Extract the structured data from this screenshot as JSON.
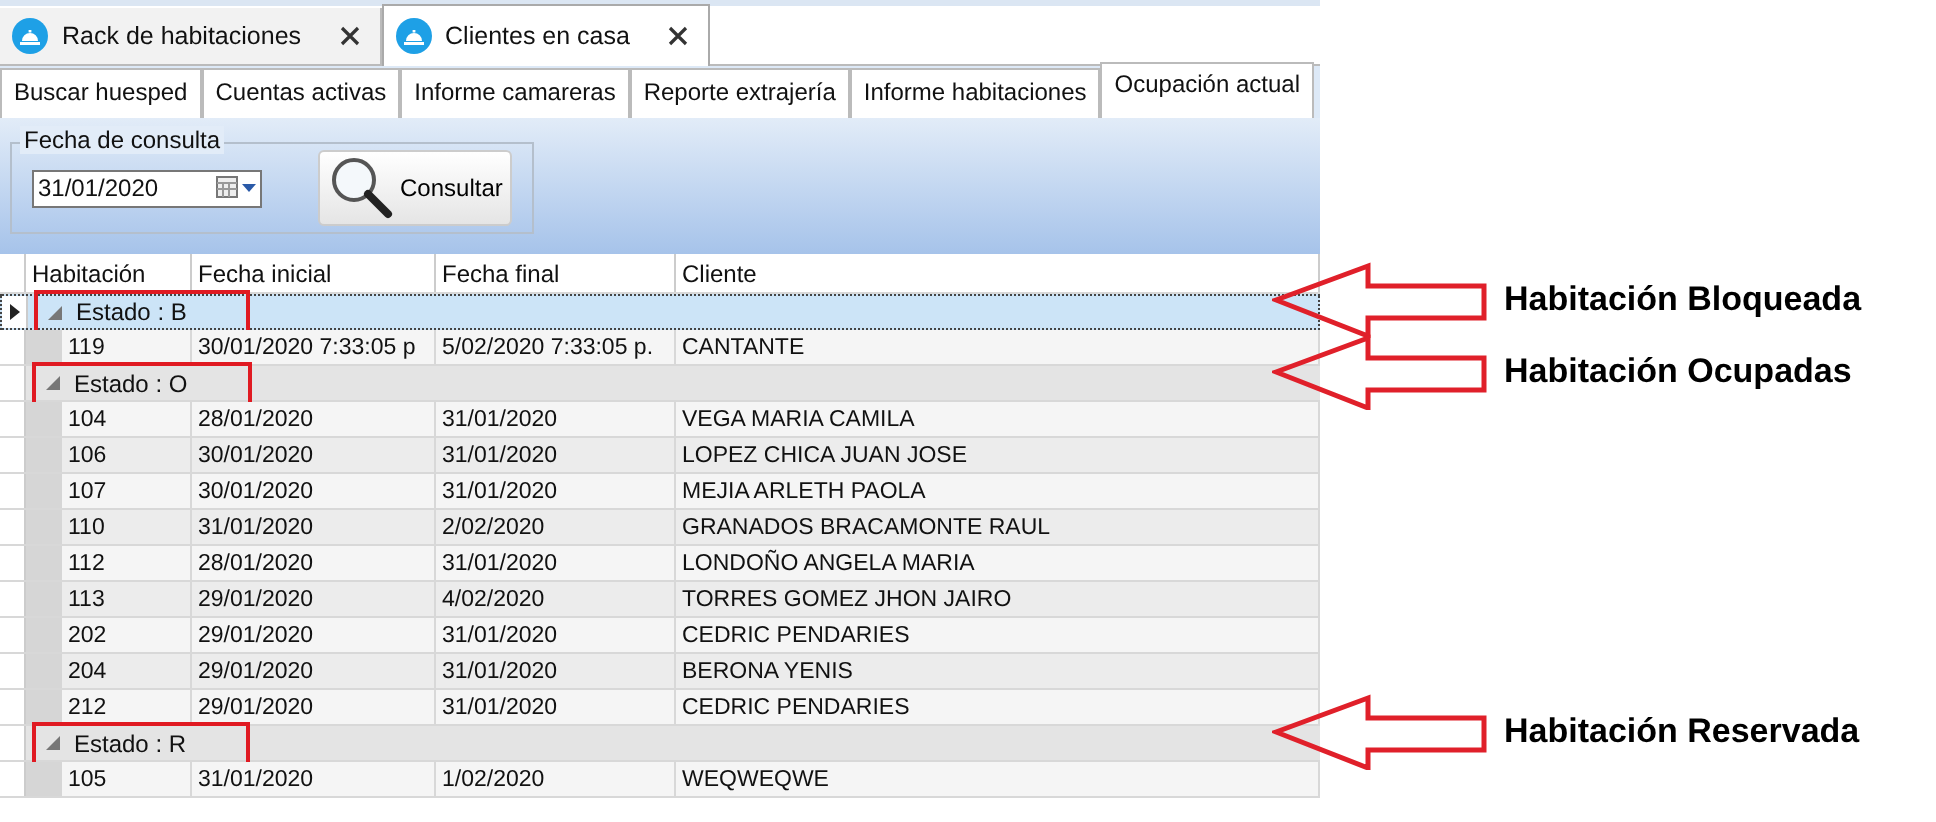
{
  "document_tabs": [
    {
      "label": "Rack de habitaciones",
      "selected": false
    },
    {
      "label": "Clientes en casa",
      "selected": true
    }
  ],
  "tabs": [
    {
      "label": "Buscar huesped",
      "selected": false
    },
    {
      "label": "Cuentas activas",
      "selected": false
    },
    {
      "label": "Informe camareras",
      "selected": false
    },
    {
      "label": "Reporte extrajería",
      "selected": false
    },
    {
      "label": "Informe habitaciones",
      "selected": false
    },
    {
      "label": "Ocupación actual",
      "selected": true
    }
  ],
  "query": {
    "group_title": "Fecha de consulta",
    "date": "31/01/2020",
    "button": "Consultar"
  },
  "table": {
    "columns": [
      "Habitación",
      "Fecha inicial",
      "Fecha final",
      "Cliente"
    ],
    "groups": [
      {
        "label": "Estado : B",
        "annotation": "Habitación Bloqueada",
        "expanded": true,
        "selected": true,
        "rows": [
          [
            "119",
            "30/01/2020 7:33:05 p",
            "5/02/2020 7:33:05 p.",
            "CANTANTE"
          ]
        ]
      },
      {
        "label": "Estado : O",
        "annotation": "Habitación Ocupadas",
        "expanded": true,
        "selected": false,
        "rows": [
          [
            "104",
            "28/01/2020",
            "31/01/2020",
            "VEGA  MARIA CAMILA"
          ],
          [
            "106",
            "30/01/2020",
            "31/01/2020",
            "LOPEZ CHICA JUAN JOSE"
          ],
          [
            "107",
            "30/01/2020",
            "31/01/2020",
            "MEJIA ARLETH PAOLA"
          ],
          [
            "110",
            "31/01/2020",
            "2/02/2020",
            "GRANADOS BRACAMONTE RAUL"
          ],
          [
            "112",
            "28/01/2020",
            "31/01/2020",
            "LONDOÑO  ANGELA MARIA"
          ],
          [
            "113",
            "29/01/2020",
            "4/02/2020",
            "TORRES GOMEZ JHON JAIRO"
          ],
          [
            "202",
            "29/01/2020",
            "31/01/2020",
            "CEDRIC PENDARIES"
          ],
          [
            "204",
            "29/01/2020",
            "31/01/2020",
            "BERONA YENIS"
          ],
          [
            "212",
            "29/01/2020",
            "31/01/2020",
            "CEDRIC PENDARIES"
          ]
        ]
      },
      {
        "label": "Estado : R",
        "annotation": "Habitación Reservada",
        "expanded": true,
        "selected": false,
        "rows": [
          [
            "105",
            "31/01/2020",
            "1/02/2020",
            "WEQWEQWE"
          ]
        ]
      }
    ]
  }
}
